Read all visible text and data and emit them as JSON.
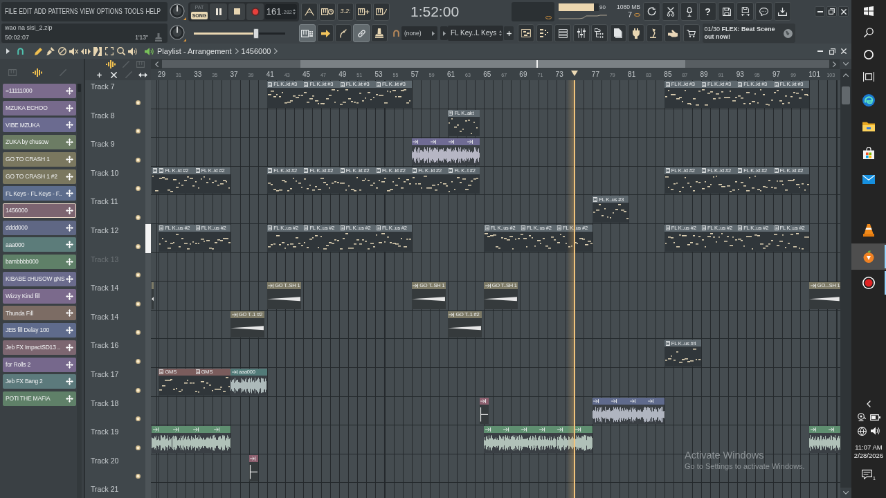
{
  "menu": [
    "FILE",
    "EDIT",
    "ADD",
    "PATTERNS",
    "VIEW",
    "OPTIONS",
    "TOOLS",
    "HELP"
  ],
  "transport": {
    "modes": [
      {
        "label": "PAT",
        "selected": false
      },
      {
        "label": "SONG",
        "selected": true
      }
    ],
    "playing": true,
    "tempo": "161",
    "tempo_fraction": ".282",
    "countdown": "3.2:",
    "time": "1:52:00"
  },
  "meters": {
    "cpu": {
      "level": 0.88,
      "reading": "90"
    },
    "memory": "1080 MB",
    "polyphony": "7"
  },
  "help": "?",
  "song": {
    "file": "wao na sisi_2.zip",
    "elapsed": "50:02:07",
    "length": "1'13\""
  },
  "master_pitch": {
    "level": 0.69
  },
  "record_tools": [
    {
      "on": true
    },
    {
      "on": false
    },
    {
      "on": false
    },
    {
      "on": true
    },
    {
      "on": false
    }
  ],
  "snap": "(none)",
  "pattern_selector": "FL Key..L Keys",
  "news": "01/30 **FLEX: Beat Scene out now!**",
  "playlist": {
    "tools": [
      {
        "selected": true
      },
      {
        "selected": false
      },
      {
        "selected": false
      },
      {
        "selected": false
      },
      {
        "selected": false
      },
      {
        "selected": false
      },
      {
        "selected": false
      },
      {
        "selected": false
      },
      {
        "selected": false
      }
    ],
    "title": "Playlist - Arrangement",
    "pattern": "1456000",
    "ruler": [
      {
        "label": "29",
        "major": true
      },
      {
        "label": "31",
        "major": false
      },
      {
        "label": "33",
        "major": true
      },
      {
        "label": "35",
        "major": false
      },
      {
        "label": "37",
        "major": true
      },
      {
        "label": "39",
        "major": false
      },
      {
        "label": "41",
        "major": true
      },
      {
        "label": "43",
        "major": false
      },
      {
        "label": "45",
        "major": true
      },
      {
        "label": "47",
        "major": false
      },
      {
        "label": "49",
        "major": true
      },
      {
        "label": "51",
        "major": false
      },
      {
        "label": "53",
        "major": true
      },
      {
        "label": "55",
        "major": false
      },
      {
        "label": "57",
        "major": true
      },
      {
        "label": "59",
        "major": false
      },
      {
        "label": "61",
        "major": true
      },
      {
        "label": "63",
        "major": false
      },
      {
        "label": "65",
        "major": true
      },
      {
        "label": "67",
        "major": false
      },
      {
        "label": "69",
        "major": true
      },
      {
        "label": "71",
        "major": false
      },
      {
        "label": "73",
        "major": true
      },
      {
        "label": "77",
        "major": true
      },
      {
        "label": "79",
        "major": false
      },
      {
        "label": "81",
        "major": true
      },
      {
        "label": "83",
        "major": false
      },
      {
        "label": "85",
        "major": true
      },
      {
        "label": "87",
        "major": false
      },
      {
        "label": "89",
        "major": true
      },
      {
        "label": "91",
        "major": false
      },
      {
        "label": "93",
        "major": true
      },
      {
        "label": "95",
        "major": false
      },
      {
        "label": "97",
        "major": true
      },
      {
        "label": "99",
        "major": false
      },
      {
        "label": "101",
        "major": true
      },
      {
        "label": "103",
        "major": false
      }
    ],
    "tracks": [
      {
        "name": "Track 7",
        "selected": false,
        "disabled": false,
        "clips": [
          {
            "kind": "pattern",
            "name": "FL K..kt #3",
            "color": "#5e686e"
          },
          {
            "kind": "pattern",
            "name": "FL K..kt #3",
            "color": "#5e686e"
          },
          {
            "kind": "pattern",
            "name": "FL K..kt #3",
            "color": "#5e686e"
          },
          {
            "kind": "pattern",
            "name": "FL K..kt #3",
            "color": "#5e686e"
          },
          {
            "kind": "pattern",
            "name": "FL K..kt #3",
            "color": "#5e686e"
          },
          {
            "kind": "pattern",
            "name": "FL K..kt #3",
            "color": "#5e686e"
          },
          {
            "kind": "pattern",
            "name": "FL K..kt #3",
            "color": "#5e686e"
          },
          {
            "kind": "pattern",
            "name": "FL K..kt #3",
            "color": "#5e686e"
          }
        ]
      },
      {
        "name": "Track 8",
        "selected": false,
        "disabled": false,
        "clips": [
          {
            "kind": "pattern",
            "name": "FL K..akt",
            "color": "#5e686e"
          }
        ]
      },
      {
        "name": "Track 9",
        "selected": false,
        "disabled": false,
        "clips": [
          {
            "kind": "audio",
            "color": "#6f6b94"
          },
          {
            "kind": "audio",
            "color": "#6f6b94"
          },
          {
            "kind": "audio",
            "color": "#6f6b94"
          },
          {
            "kind": "audio",
            "color": "#6f6b94"
          }
        ]
      },
      {
        "name": "Track 10",
        "selected": false,
        "disabled": false,
        "clips": [
          {
            "kind": "pattern",
            "color": "#5e686e"
          },
          {
            "kind": "pattern",
            "name": "FL K..kt #2",
            "color": "#5e686e"
          },
          {
            "kind": "pattern",
            "name": "FL K..kt #2",
            "color": "#5e686e"
          },
          {
            "kind": "pattern",
            "name": "FL K..kt #2",
            "color": "#5e686e"
          },
          {
            "kind": "pattern",
            "name": "FL K..kt #2",
            "color": "#5e686e"
          },
          {
            "kind": "pattern",
            "name": "FL K..kt #2",
            "color": "#5e686e"
          },
          {
            "kind": "pattern",
            "name": "FL K..kt #2",
            "color": "#5e686e"
          },
          {
            "kind": "pattern",
            "name": "FL K..kt #2",
            "color": "#5e686e"
          },
          {
            "kind": "pattern",
            "name": "FL K..t #2",
            "color": "#5e686e"
          },
          {
            "kind": "pattern",
            "name": "FL K..kt #2",
            "color": "#5e686e"
          },
          {
            "kind": "pattern",
            "name": "FL K..kt #2",
            "color": "#5e686e"
          },
          {
            "kind": "pattern",
            "name": "FL K..kt #2",
            "color": "#5e686e"
          },
          {
            "kind": "pattern",
            "name": "FL K..kt #2",
            "color": "#5e686e"
          }
        ]
      },
      {
        "name": "Track 11",
        "selected": false,
        "disabled": false,
        "clips": [
          {
            "kind": "pattern",
            "name": "FL K..us #3",
            "color": "#5e686e"
          }
        ]
      },
      {
        "name": "Track 12",
        "selected": true,
        "disabled": false,
        "clips": [
          {
            "kind": "pattern",
            "name": "FL K..us #2",
            "color": "#5e686e"
          },
          {
            "kind": "pattern",
            "name": "FL K..us #2",
            "color": "#5e686e"
          },
          {
            "kind": "pattern",
            "name": "FL K..us #2",
            "color": "#5e686e"
          },
          {
            "kind": "pattern",
            "name": "FL K..us #2",
            "color": "#5e686e"
          },
          {
            "kind": "pattern",
            "name": "FL K..us #2",
            "color": "#5e686e"
          },
          {
            "kind": "pattern",
            "name": "FL K..us #2",
            "color": "#5e686e"
          },
          {
            "kind": "pattern",
            "name": "FL K..us #2",
            "color": "#5e686e"
          },
          {
            "kind": "pattern",
            "name": "FL K..us #2",
            "color": "#5e686e"
          },
          {
            "kind": "pattern",
            "name": "FL K..us #2",
            "color": "#5e686e"
          },
          {
            "kind": "pattern",
            "name": "FL K..us #2",
            "color": "#5e686e"
          },
          {
            "kind": "pattern",
            "name": "FL K..us #2",
            "color": "#5e686e"
          },
          {
            "kind": "pattern",
            "name": "FL K..us #2",
            "color": "#5e686e"
          },
          {
            "kind": "pattern",
            "name": "FL K..us #2",
            "color": "#5e686e"
          }
        ]
      },
      {
        "name": "Track 13",
        "selected": false,
        "disabled": true
      },
      {
        "name": "Track 14",
        "selected": false,
        "disabled": false,
        "clips": [
          {
            "kind": "sweep",
            "color": "#7d7a66"
          },
          {
            "kind": "sweep",
            "name": "GO T..SH 1",
            "color": "#7d7a66"
          },
          {
            "kind": "sweep",
            "name": "GO T..SH 1",
            "color": "#7d7a66"
          },
          {
            "kind": "sweep",
            "name": "GO T..SH 1",
            "color": "#7d7a66"
          },
          {
            "kind": "sweep",
            "name": "GO...SH 1",
            "color": "#7d7a66"
          }
        ]
      },
      {
        "name": "Track 14",
        "selected": false,
        "disabled": false,
        "clips": [
          {
            "kind": "sweep",
            "name": "GO T..1 #2",
            "color": "#7d7a66"
          },
          {
            "kind": "sweep",
            "name": "GO T..1 #2",
            "color": "#7d7a66"
          }
        ]
      },
      {
        "name": "Track 16",
        "selected": false,
        "disabled": false,
        "clips": [
          {
            "kind": "pattern",
            "name": "FL K..us #4",
            "color": "#5e686e"
          }
        ]
      },
      {
        "name": "Track 17",
        "selected": false,
        "disabled": false,
        "clips": [
          {
            "kind": "pattern",
            "name": "GMS",
            "color": "#7a5c5c"
          },
          {
            "kind": "pattern",
            "name": "GMS",
            "color": "#7a5c5c"
          },
          {
            "kind": "audio",
            "name": "aaa000",
            "color": "#527a78"
          }
        ]
      },
      {
        "name": "Track 18",
        "selected": false,
        "disabled": false,
        "clips": [
          {
            "kind": "hit",
            "color": "#8c5f6e"
          },
          {
            "kind": "audio",
            "color": "#5f6a8c"
          },
          {
            "kind": "audio",
            "color": "#5f6a8c"
          },
          {
            "kind": "audio",
            "color": "#5f6a8c"
          },
          {
            "kind": "audio",
            "color": "#5f6a8c"
          }
        ]
      },
      {
        "name": "Track 19",
        "selected": false,
        "disabled": false,
        "clips": [
          {
            "kind": "audio",
            "color": "#5f8f70"
          },
          {
            "kind": "audio",
            "color": "#5f8f70"
          },
          {
            "kind": "audio",
            "color": "#5f8f70"
          },
          {
            "kind": "audio",
            "color": "#5f8f70"
          },
          {
            "kind": "audio",
            "color": "#5f8f70"
          },
          {
            "kind": "audio",
            "color": "#5f8f70"
          },
          {
            "kind": "audio",
            "color": "#5f8f70"
          },
          {
            "kind": "audio",
            "color": "#5f8f70"
          },
          {
            "kind": "audio",
            "color": "#5f8f70"
          },
          {
            "kind": "audio",
            "color": "#5f8f70"
          },
          {
            "kind": "audio",
            "color": "#5f8f70"
          },
          {
            "kind": "audio",
            "color": "#5f8f70"
          }
        ]
      },
      {
        "name": "Track 20",
        "selected": false,
        "disabled": false,
        "clips": [
          {
            "kind": "hit",
            "color": "#8c5f6e"
          }
        ]
      },
      {
        "name": "Track 21",
        "selected": false,
        "disabled": false
      }
    ]
  },
  "picker": {
    "tabs": [
      {
        "selected": false
      },
      {
        "selected": true
      },
      {
        "selected": false
      }
    ],
    "patterns": [
      {
        "name": "=11111000",
        "color": "#7b6b8c",
        "selected": false
      },
      {
        "name": "MZUKA ECHOO",
        "color": "#776a8c",
        "selected": false
      },
      {
        "name": "VIBE MZUKA",
        "color": "#6b6b90",
        "selected": false
      },
      {
        "name": "ZUKA by chusow",
        "color": "#6c7c64",
        "selected": false
      },
      {
        "name": "GO TO CRASH 1",
        "color": "#7a775f",
        "selected": false
      },
      {
        "name": "GO TO CRASH 1 #2",
        "color": "#7a775f",
        "selected": false
      },
      {
        "name": "FL Keys - FL Keys - F..",
        "color": "#5d6d8c",
        "selected": false
      },
      {
        "name": "1456000",
        "color": "#7c6470",
        "selected": true
      },
      {
        "name": "dddd000",
        "color": "#5f6784",
        "selected": false
      },
      {
        "name": "aaa000",
        "color": "#5c7c7a",
        "selected": false
      },
      {
        "name": "bambbbb000",
        "color": "#5f8068",
        "selected": false
      },
      {
        "name": "KIBABE cHUSOW gNS",
        "color": "#6a6b8c",
        "selected": false
      },
      {
        "name": "Wizzy Kind fill",
        "color": "#7b6a8c",
        "selected": false
      },
      {
        "name": "Thunda Fill",
        "color": "#7c6c64",
        "selected": false
      },
      {
        "name": "JEB fill Delay 100",
        "color": "#5f6b8c",
        "selected": false
      },
      {
        "name": "Jeb FX ImpactSD13 ..",
        "color": "#7c6670",
        "selected": false
      },
      {
        "name": "for Rolls 2",
        "color": "#76688c",
        "selected": false
      },
      {
        "name": "Jeb FX Bang 2",
        "color": "#5c7a7c",
        "selected": false
      },
      {
        "name": "POTI THE MAFIA",
        "color": "#5f8068",
        "selected": false
      }
    ]
  },
  "windows": {
    "activation": {
      "title": "Activate Windows",
      "hint": "Go to Settings to activate Windows."
    },
    "taskbar": {
      "apps": [
        {
          "selected": false,
          "running": false
        },
        {
          "selected": false,
          "running": false
        },
        {
          "selected": false,
          "running": false
        },
        {
          "selected": false,
          "running": false
        },
        {
          "selected": false,
          "running": false
        },
        {
          "selected": true,
          "running": true
        },
        {
          "selected": false,
          "running": true
        }
      ],
      "time": "11:07 AM",
      "date": "2/28/2026",
      "notifications": "1"
    }
  }
}
